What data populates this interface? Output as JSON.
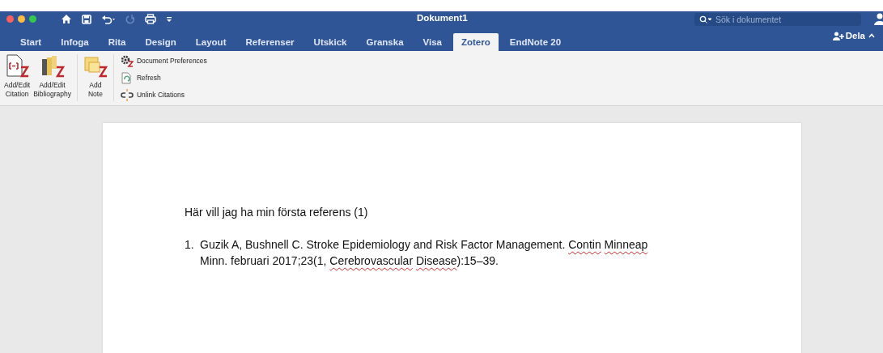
{
  "window": {
    "title": "Dokument1"
  },
  "quick_access": [
    {
      "kind": "home",
      "disabled": false
    },
    {
      "kind": "save",
      "disabled": false
    },
    {
      "kind": "undo",
      "disabled": false
    },
    {
      "kind": "redo",
      "disabled": true
    },
    {
      "kind": "print",
      "disabled": false
    },
    {
      "kind": "more",
      "disabled": false
    }
  ],
  "search": {
    "placeholder": "Sök i dokumentet"
  },
  "tabs": [
    {
      "label": "Start",
      "selected": false
    },
    {
      "label": "Infoga",
      "selected": false
    },
    {
      "label": "Rita",
      "selected": false
    },
    {
      "label": "Design",
      "selected": false
    },
    {
      "label": "Layout",
      "selected": false
    },
    {
      "label": "Referenser",
      "selected": false
    },
    {
      "label": "Utskick",
      "selected": false
    },
    {
      "label": "Granska",
      "selected": false
    },
    {
      "label": "Visa",
      "selected": false
    },
    {
      "label": "Zotero",
      "selected": true
    },
    {
      "label": "EndNote 20",
      "selected": false
    }
  ],
  "share": {
    "label": "Dela"
  },
  "ribbon": {
    "groups": [
      {
        "kind": "large",
        "items": [
          {
            "kind": "citation",
            "label": "Add/Edit\nCitation"
          },
          {
            "kind": "bibliography",
            "label": "Add/Edit\nBibliography"
          }
        ]
      },
      {
        "kind": "large",
        "items": [
          {
            "kind": "note",
            "label": "Add\nNote"
          }
        ]
      },
      {
        "kind": "small",
        "items": [
          {
            "kind": "preferences",
            "label": "Document Preferences"
          },
          {
            "kind": "refresh",
            "label": "Refresh"
          },
          {
            "kind": "unlink",
            "label": "Unlink Citations"
          }
        ]
      }
    ]
  },
  "document": {
    "paragraphs": [
      {
        "kind": "text",
        "text": "Här vill jag ha min första referens (1)"
      },
      {
        "kind": "reference",
        "number": "1.",
        "segments": [
          {
            "text": "Guzik A, Bushnell C. Stroke Epidemiology and Risk Factor Management.",
            "misspelled": false,
            "space_after": true
          },
          {
            "text": "Contin",
            "misspelled": true,
            "space_after": true
          },
          {
            "text": "Minneap",
            "misspelled": true,
            "space_after": true
          },
          {
            "text": "Minn. februari 2017;23(1,",
            "misspelled": false,
            "space_after": true
          },
          {
            "text": "Cerebrovascular",
            "misspelled": true,
            "space_after": true
          },
          {
            "text": "Disease",
            "misspelled": true,
            "space_after": false
          },
          {
            "text": "):15–39.",
            "misspelled": false,
            "space_after": false
          }
        ]
      }
    ]
  }
}
